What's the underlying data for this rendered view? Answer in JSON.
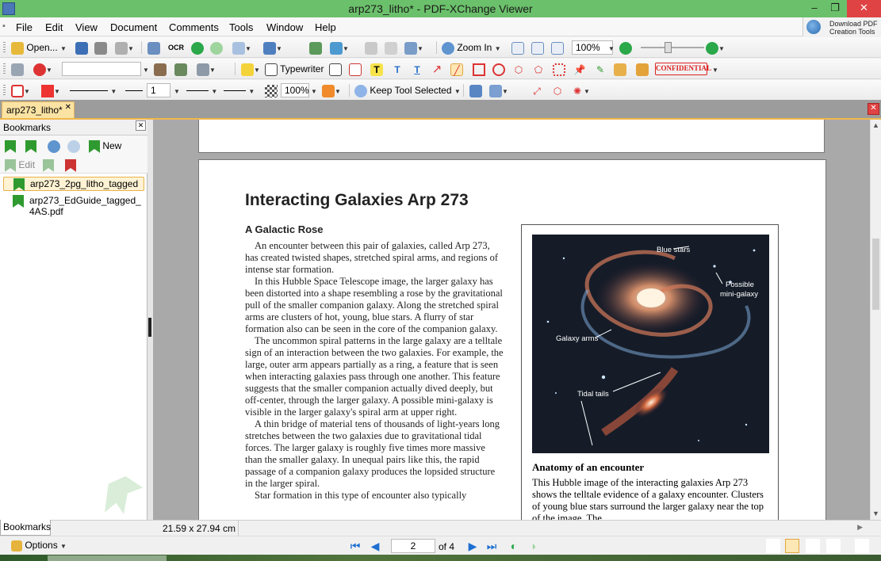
{
  "window": {
    "title": "arp273_litho* - PDF-XChange Viewer",
    "min": "–",
    "max": "❐",
    "close": "✕"
  },
  "menu": [
    "File",
    "Edit",
    "View",
    "Document",
    "Comments",
    "Tools",
    "Window",
    "Help"
  ],
  "download_box": {
    "line1": "Download PDF",
    "line2": "Creation Tools"
  },
  "toolbar1": {
    "open_label": "Open...",
    "ocr_label": "OCR",
    "zoom_in_label": "Zoom In",
    "zoom_value": "100%"
  },
  "toolbar2": {
    "typewriter_label": "Typewriter",
    "stamp_label": "CONFIDENTIAL"
  },
  "toolbar3": {
    "line_width_value": "1",
    "opacity_value": "100%",
    "keep_tool_label": "Keep Tool Selected"
  },
  "tab": {
    "label": "arp273_litho*",
    "close": "✕"
  },
  "bookmarks": {
    "title": "Bookmarks",
    "close": "✕",
    "new_label": "New",
    "edit_label": "Edit",
    "items": [
      {
        "label": "arp273_2pg_litho_tagged",
        "selected": true
      },
      {
        "label": "arp273_EdGuide_tagged_4AS.pdf",
        "selected": false
      }
    ],
    "panel_tab": "Bookmarks"
  },
  "document": {
    "heading": "Interacting Galaxies Arp 273",
    "subheading": "A Galactic Rose",
    "paragraphs": [
      "An encounter between this pair of galaxies, called Arp 273, has created twisted shapes, stretched spiral arms, and regions of intense star formation.",
      "In this Hubble Space Telescope image, the larger galaxy has been distorted into a shape resembling a rose by the gravitational pull of the smaller companion galaxy. Along the stretched spiral arms are clusters of hot, young, blue stars. A flurry of star formation also can be seen in the core of the companion galaxy.",
      "The uncommon spiral patterns in the large galaxy are a telltale sign of an interaction between the two galaxies. For example, the large, outer arm appears partially as a ring, a feature that is seen when interacting galaxies pass through one another. This feature suggests that the smaller companion actually dived deeply, but off-center, through the larger galaxy. A possible mini-galaxy is visible in the larger galaxy's spiral arm at upper right.",
      "A thin bridge of material tens of thousands of light-years long stretches between the two galaxies due to gravitational tidal forces. The larger galaxy is roughly five times more massive than the smaller galaxy. In unequal pairs like this, the rapid passage of a companion galaxy produces the lopsided structure in the larger spiral.",
      "Star formation in this type of encounter also typically"
    ],
    "figure": {
      "labels": {
        "blue_stars": "Blue stars",
        "mini_galaxy_1": "Possible",
        "mini_galaxy_2": "mini-galaxy",
        "galaxy_arms": "Galaxy arms",
        "tidal_tails": "Tidal tails"
      },
      "caption_title": "Anatomy of an encounter",
      "caption": "This Hubble image of the interacting galaxies Arp 273 shows the telltale evidence of a galaxy encounter. Clusters of young blue stars surround the larger galaxy near the top of the image. The"
    }
  },
  "status": {
    "page_size": "21.59 x 27.94 cm"
  },
  "nav": {
    "options_label": "Options",
    "page_value": "2",
    "page_of": "of 4"
  },
  "colors": {
    "titlebar": "#6bc16b",
    "accent": "#f0b84a",
    "close_red": "#e04343",
    "nav_blue": "#1e6fd1"
  }
}
